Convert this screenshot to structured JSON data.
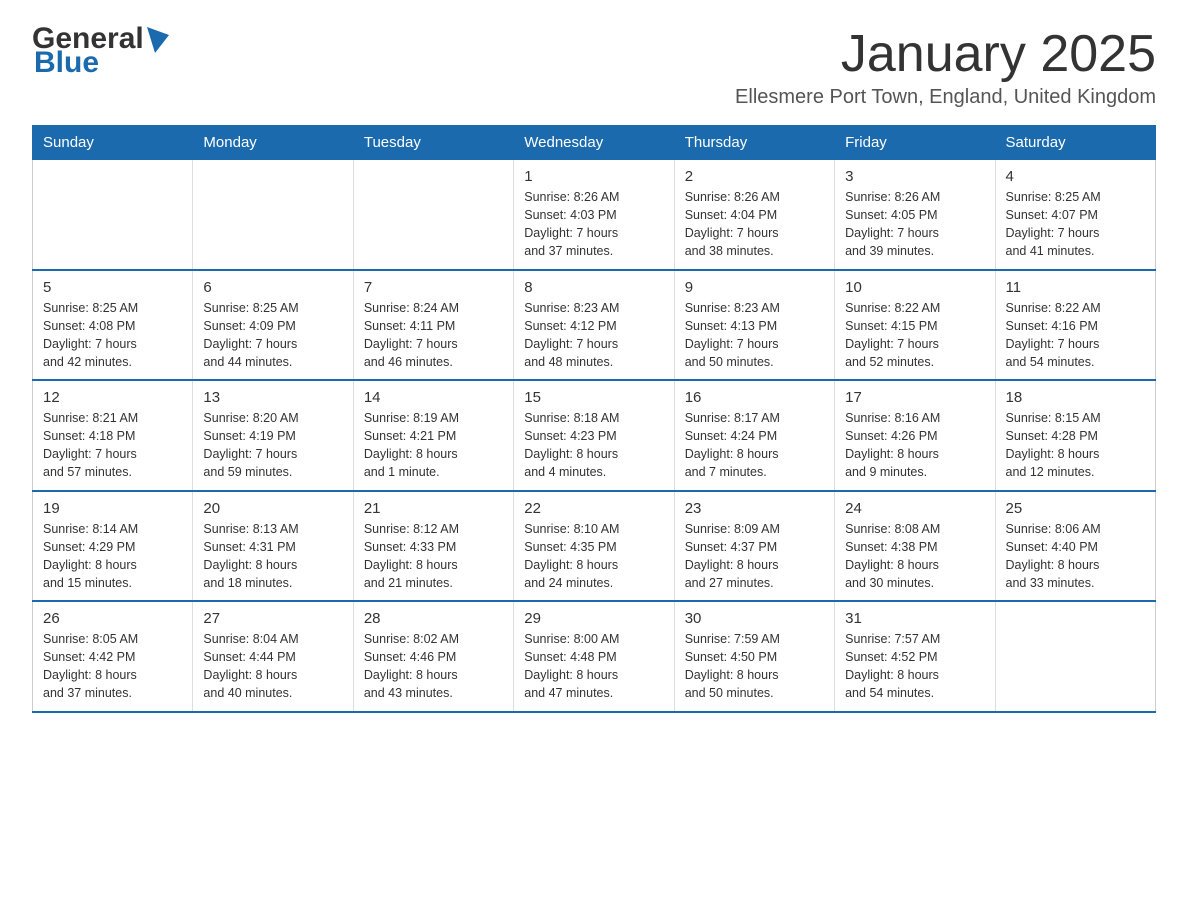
{
  "logo": {
    "general": "General",
    "blue": "Blue"
  },
  "title": "January 2025",
  "location": "Ellesmere Port Town, England, United Kingdom",
  "weekdays": [
    "Sunday",
    "Monday",
    "Tuesday",
    "Wednesday",
    "Thursday",
    "Friday",
    "Saturday"
  ],
  "weeks": [
    [
      {
        "day": "",
        "info": ""
      },
      {
        "day": "",
        "info": ""
      },
      {
        "day": "",
        "info": ""
      },
      {
        "day": "1",
        "info": "Sunrise: 8:26 AM\nSunset: 4:03 PM\nDaylight: 7 hours\nand 37 minutes."
      },
      {
        "day": "2",
        "info": "Sunrise: 8:26 AM\nSunset: 4:04 PM\nDaylight: 7 hours\nand 38 minutes."
      },
      {
        "day": "3",
        "info": "Sunrise: 8:26 AM\nSunset: 4:05 PM\nDaylight: 7 hours\nand 39 minutes."
      },
      {
        "day": "4",
        "info": "Sunrise: 8:25 AM\nSunset: 4:07 PM\nDaylight: 7 hours\nand 41 minutes."
      }
    ],
    [
      {
        "day": "5",
        "info": "Sunrise: 8:25 AM\nSunset: 4:08 PM\nDaylight: 7 hours\nand 42 minutes."
      },
      {
        "day": "6",
        "info": "Sunrise: 8:25 AM\nSunset: 4:09 PM\nDaylight: 7 hours\nand 44 minutes."
      },
      {
        "day": "7",
        "info": "Sunrise: 8:24 AM\nSunset: 4:11 PM\nDaylight: 7 hours\nand 46 minutes."
      },
      {
        "day": "8",
        "info": "Sunrise: 8:23 AM\nSunset: 4:12 PM\nDaylight: 7 hours\nand 48 minutes."
      },
      {
        "day": "9",
        "info": "Sunrise: 8:23 AM\nSunset: 4:13 PM\nDaylight: 7 hours\nand 50 minutes."
      },
      {
        "day": "10",
        "info": "Sunrise: 8:22 AM\nSunset: 4:15 PM\nDaylight: 7 hours\nand 52 minutes."
      },
      {
        "day": "11",
        "info": "Sunrise: 8:22 AM\nSunset: 4:16 PM\nDaylight: 7 hours\nand 54 minutes."
      }
    ],
    [
      {
        "day": "12",
        "info": "Sunrise: 8:21 AM\nSunset: 4:18 PM\nDaylight: 7 hours\nand 57 minutes."
      },
      {
        "day": "13",
        "info": "Sunrise: 8:20 AM\nSunset: 4:19 PM\nDaylight: 7 hours\nand 59 minutes."
      },
      {
        "day": "14",
        "info": "Sunrise: 8:19 AM\nSunset: 4:21 PM\nDaylight: 8 hours\nand 1 minute."
      },
      {
        "day": "15",
        "info": "Sunrise: 8:18 AM\nSunset: 4:23 PM\nDaylight: 8 hours\nand 4 minutes."
      },
      {
        "day": "16",
        "info": "Sunrise: 8:17 AM\nSunset: 4:24 PM\nDaylight: 8 hours\nand 7 minutes."
      },
      {
        "day": "17",
        "info": "Sunrise: 8:16 AM\nSunset: 4:26 PM\nDaylight: 8 hours\nand 9 minutes."
      },
      {
        "day": "18",
        "info": "Sunrise: 8:15 AM\nSunset: 4:28 PM\nDaylight: 8 hours\nand 12 minutes."
      }
    ],
    [
      {
        "day": "19",
        "info": "Sunrise: 8:14 AM\nSunset: 4:29 PM\nDaylight: 8 hours\nand 15 minutes."
      },
      {
        "day": "20",
        "info": "Sunrise: 8:13 AM\nSunset: 4:31 PM\nDaylight: 8 hours\nand 18 minutes."
      },
      {
        "day": "21",
        "info": "Sunrise: 8:12 AM\nSunset: 4:33 PM\nDaylight: 8 hours\nand 21 minutes."
      },
      {
        "day": "22",
        "info": "Sunrise: 8:10 AM\nSunset: 4:35 PM\nDaylight: 8 hours\nand 24 minutes."
      },
      {
        "day": "23",
        "info": "Sunrise: 8:09 AM\nSunset: 4:37 PM\nDaylight: 8 hours\nand 27 minutes."
      },
      {
        "day": "24",
        "info": "Sunrise: 8:08 AM\nSunset: 4:38 PM\nDaylight: 8 hours\nand 30 minutes."
      },
      {
        "day": "25",
        "info": "Sunrise: 8:06 AM\nSunset: 4:40 PM\nDaylight: 8 hours\nand 33 minutes."
      }
    ],
    [
      {
        "day": "26",
        "info": "Sunrise: 8:05 AM\nSunset: 4:42 PM\nDaylight: 8 hours\nand 37 minutes."
      },
      {
        "day": "27",
        "info": "Sunrise: 8:04 AM\nSunset: 4:44 PM\nDaylight: 8 hours\nand 40 minutes."
      },
      {
        "day": "28",
        "info": "Sunrise: 8:02 AM\nSunset: 4:46 PM\nDaylight: 8 hours\nand 43 minutes."
      },
      {
        "day": "29",
        "info": "Sunrise: 8:00 AM\nSunset: 4:48 PM\nDaylight: 8 hours\nand 47 minutes."
      },
      {
        "day": "30",
        "info": "Sunrise: 7:59 AM\nSunset: 4:50 PM\nDaylight: 8 hours\nand 50 minutes."
      },
      {
        "day": "31",
        "info": "Sunrise: 7:57 AM\nSunset: 4:52 PM\nDaylight: 8 hours\nand 54 minutes."
      },
      {
        "day": "",
        "info": ""
      }
    ]
  ]
}
